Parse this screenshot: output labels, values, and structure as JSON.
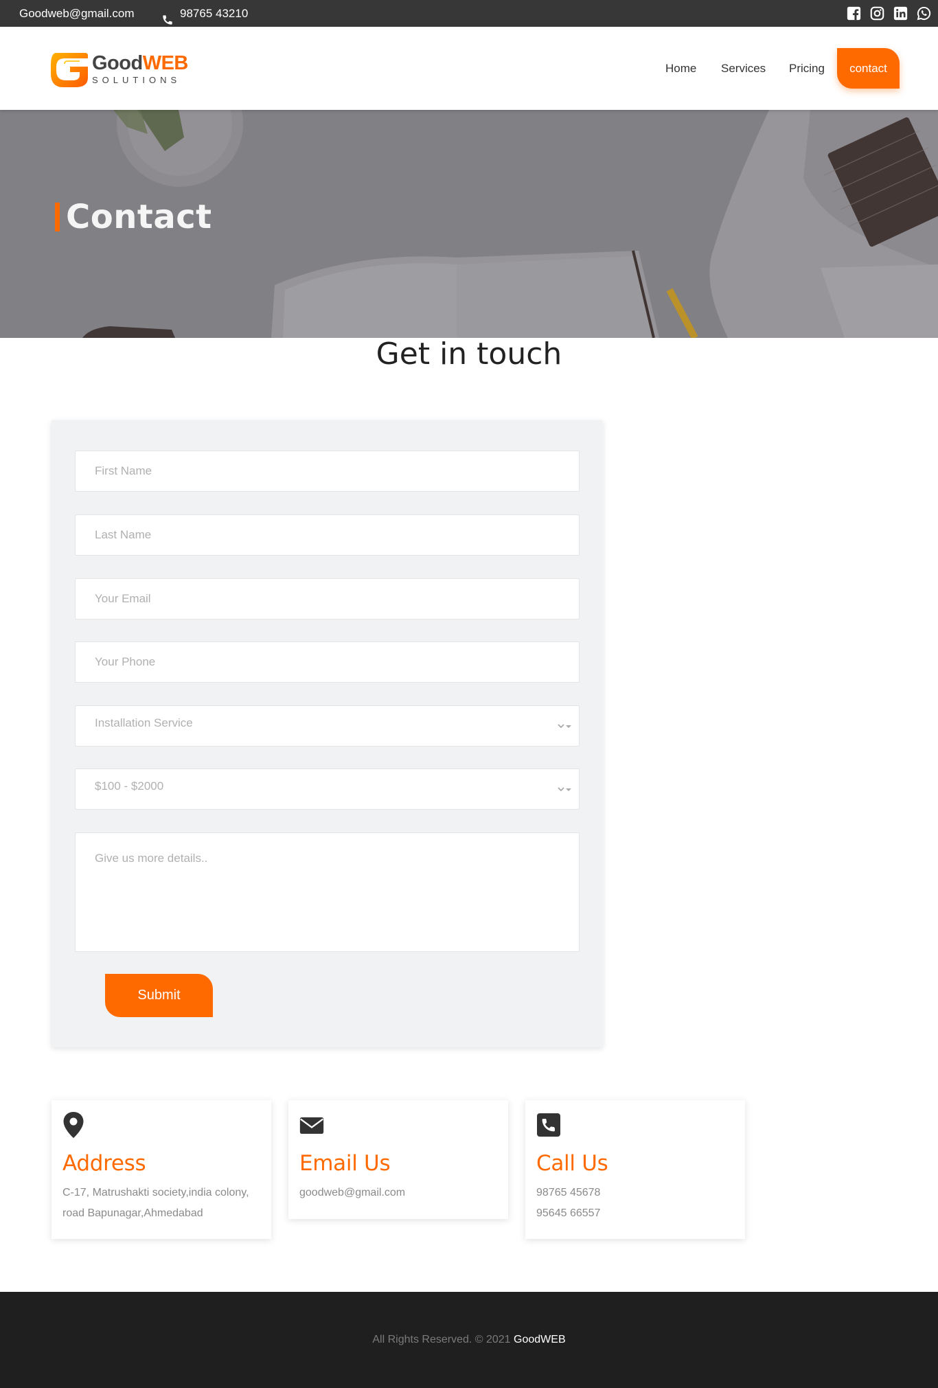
{
  "topbar": {
    "email": "Goodweb@gmail.com",
    "phone": "98765 43210",
    "socials": [
      "facebook-icon",
      "instagram-icon",
      "linkedin-icon",
      "whatsapp-icon"
    ]
  },
  "header": {
    "logo": {
      "word1": "Good",
      "word2": "WEB",
      "tagline": "SOLUTIONS"
    },
    "nav": {
      "home": "Home",
      "services": "Services",
      "pricing": "Pricing",
      "contact": "contact"
    }
  },
  "hero": {
    "title": "Contact"
  },
  "main": {
    "heading": "Get in touch"
  },
  "form": {
    "first_name_placeholder": "First Name",
    "last_name_placeholder": "Last Name",
    "email_placeholder": "Your Email",
    "phone_placeholder": "Your Phone",
    "service_selected": "Installation Service",
    "budget_selected": "$100 - $2000",
    "details_placeholder": "Give us more details..",
    "submit_label": "Submit"
  },
  "info": {
    "address": {
      "title": "Address",
      "line1": "C-17, Matrushakti society,india colony,",
      "line2": "road Bapunagar,Ahmedabad"
    },
    "email": {
      "title": "Email Us",
      "line1": "goodweb@gmail.com"
    },
    "call": {
      "title": "Call Us",
      "line1": "98765 45678",
      "line2": "95645 66557"
    }
  },
  "footer": {
    "text": "All Rights Reserved. © 2021 ",
    "brand": "GoodWEB"
  },
  "colors": {
    "accent": "#ff6a00",
    "topbar": "#373737",
    "footer": "#1f1f1f",
    "form_bg": "#f1f2f4"
  }
}
